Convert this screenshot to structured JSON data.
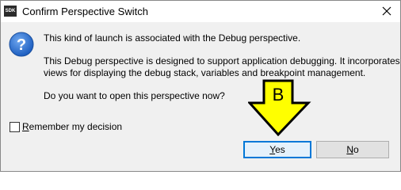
{
  "window": {
    "app_icon_text": "SDK",
    "title": "Confirm Perspective Switch"
  },
  "message": {
    "line1": "This kind of launch is associated with the Debug perspective.",
    "line2": "This Debug perspective is designed to support application debugging.  It incorporates",
    "line3": "views for displaying the debug stack, variables and breakpoint management.",
    "line4": "Do you want to open this perspective now?"
  },
  "checkbox": {
    "label_prefix": "R",
    "label_rest": "emember my decision",
    "checked": false
  },
  "buttons": {
    "yes_prefix": "Y",
    "yes_rest": "es",
    "no_prefix": "N",
    "no_rest": "o"
  },
  "annotation": {
    "label": "B",
    "color": "#ffff00"
  }
}
